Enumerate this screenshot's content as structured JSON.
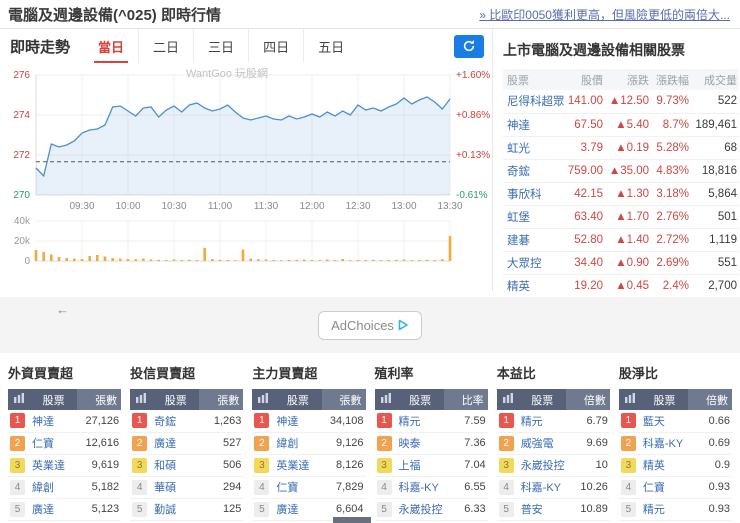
{
  "page": {
    "title": "電腦及週邊設備(^025) 即時行情",
    "promo_link": "» 比歐印0050獲利更高，但風險更低的兩倍大..."
  },
  "chart_panel": {
    "title": "即時走勢",
    "tabs": [
      "當日",
      "二日",
      "三日",
      "四日",
      "五日"
    ],
    "active_tab": "當日",
    "watermark": "WantGoo 玩股網"
  },
  "chart_data": {
    "type": "line",
    "title": "電腦及週邊設備(^025) 當日即時走勢",
    "x": [
      "09:00",
      "09:05",
      "09:10",
      "09:15",
      "09:20",
      "09:25",
      "09:30",
      "09:35",
      "09:40",
      "09:45",
      "09:50",
      "09:55",
      "10:00",
      "10:05",
      "10:10",
      "10:15",
      "10:20",
      "10:25",
      "10:30",
      "10:35",
      "10:40",
      "10:45",
      "10:50",
      "10:55",
      "11:00",
      "11:05",
      "11:10",
      "11:15",
      "11:20",
      "11:25",
      "11:30",
      "11:35",
      "11:40",
      "11:45",
      "11:50",
      "11:55",
      "12:00",
      "12:05",
      "12:10",
      "12:15",
      "12:20",
      "12:25",
      "12:30",
      "12:35",
      "12:40",
      "12:45",
      "12:50",
      "12:55",
      "13:00",
      "13:05",
      "13:10",
      "13:15",
      "13:20",
      "13:25",
      "13:30"
    ],
    "series": [
      {
        "name": "指數",
        "color": "#4a90d2",
        "fill": "rgba(74,144,210,0.13)",
        "values": [
          271.35,
          270.95,
          272.55,
          272.4,
          272.5,
          272.7,
          273.1,
          273.25,
          273.3,
          273.5,
          274.4,
          274.45,
          274.2,
          273.95,
          274.35,
          274.4,
          273.9,
          274.25,
          274.45,
          274.15,
          274.5,
          274.6,
          274.35,
          274.2,
          274.3,
          274.5,
          274.15,
          273.85,
          273.75,
          273.85,
          273.95,
          273.8,
          273.75,
          273.95,
          273.8,
          273.9,
          274.05,
          273.9,
          274.15,
          273.95,
          274.2,
          274.0,
          274.5,
          274.25,
          274.35,
          274.2,
          274.4,
          274.55,
          274.85,
          274.55,
          274.75,
          274.9,
          274.65,
          274.3,
          274.8
        ]
      }
    ],
    "volume": {
      "name": "成交量",
      "color": "#f6a93b",
      "values": [
        11000,
        9000,
        6500,
        4000,
        3000,
        2500,
        2000,
        5000,
        6000,
        4500,
        3000,
        2500,
        2000,
        1800,
        2500,
        1500,
        1200,
        1000,
        1500,
        1000,
        1200,
        900,
        13000,
        2000,
        1200,
        1000,
        800,
        11500,
        2500,
        1800,
        1500,
        1000,
        800,
        1000,
        1200,
        1500,
        1000,
        800,
        1500,
        1000,
        2000,
        800,
        1000,
        900,
        1200,
        800,
        1000,
        1200,
        1500,
        800,
        1000,
        1200,
        900,
        1800,
        25000
      ],
      "ticks": [
        {
          "label": "40k",
          "value": 40000
        },
        {
          "label": "20k",
          "value": 20000
        },
        {
          "label": "0",
          "value": 0
        }
      ]
    },
    "prev_close": 271.66,
    "prev_close_line_color": "#555555",
    "ylim": [
      270,
      276.4
    ],
    "grid": true,
    "y_ticks": [
      {
        "label": "276",
        "value": 276,
        "color": "#c9443c"
      },
      {
        "label": "274",
        "value": 274,
        "color": "#c9443c"
      },
      {
        "label": "272",
        "value": 272,
        "color": "#c9443c"
      },
      {
        "label": "270",
        "value": 270,
        "color": "#2aa05c"
      }
    ],
    "pct_ticks": [
      {
        "label": "+1.60%",
        "color": "#c9443c"
      },
      {
        "label": "+0.86%",
        "color": "#c9443c"
      },
      {
        "label": "+0.13%",
        "color": "#c9443c"
      },
      {
        "label": "-0.61%",
        "color": "#2aa05c"
      }
    ],
    "x_ticks": [
      "09:30",
      "10:00",
      "10:30",
      "11:00",
      "11:30",
      "12:00",
      "12:30",
      "13:00",
      "13:30"
    ]
  },
  "related_stocks": {
    "title": "上市電腦及週邊設備相關股票",
    "columns": [
      "股票",
      "股價",
      "漲跌",
      "漲跌幅",
      "成交量"
    ],
    "rows": [
      {
        "name": "尼得科超眾",
        "price": "141.00",
        "change": "▲12.50",
        "change_pct": "9.73%",
        "volume": "522"
      },
      {
        "name": "神達",
        "price": "67.50",
        "change": "▲5.40",
        "change_pct": "8.7%",
        "volume": "189,461"
      },
      {
        "name": "虹光",
        "price": "3.79",
        "change": "▲0.19",
        "change_pct": "5.28%",
        "volume": "68"
      },
      {
        "name": "奇鋐",
        "price": "759.00",
        "change": "▲35.00",
        "change_pct": "4.83%",
        "volume": "18,816"
      },
      {
        "name": "事欣科",
        "price": "42.15",
        "change": "▲1.30",
        "change_pct": "3.18%",
        "volume": "5,864"
      },
      {
        "name": "虹堡",
        "price": "63.40",
        "change": "▲1.70",
        "change_pct": "2.76%",
        "volume": "501"
      },
      {
        "name": "建碁",
        "price": "52.80",
        "change": "▲1.40",
        "change_pct": "2.72%",
        "volume": "1,119"
      },
      {
        "name": "大眾控",
        "price": "34.40",
        "change": "▲0.90",
        "change_pct": "2.69%",
        "volume": "551"
      },
      {
        "name": "精英",
        "price": "19.20",
        "change": "▲0.45",
        "change_pct": "2.4%",
        "volume": "2,700"
      }
    ]
  },
  "ad": {
    "label": "AdChoices",
    "arrow": "←"
  },
  "ranking": {
    "stock_col": "股票",
    "tables": [
      {
        "title": "外資買賣超",
        "value_col": "張數",
        "rows": [
          {
            "rank": 1,
            "name": "神達",
            "value": "27,126"
          },
          {
            "rank": 2,
            "name": "仁寶",
            "value": "12,616"
          },
          {
            "rank": 3,
            "name": "英業達",
            "value": "9,619"
          },
          {
            "rank": 4,
            "name": "緯創",
            "value": "5,182"
          },
          {
            "rank": 5,
            "name": "廣達",
            "value": "5,123"
          }
        ]
      },
      {
        "title": "投信買賣超",
        "value_col": "張數",
        "rows": [
          {
            "rank": 1,
            "name": "奇鋐",
            "value": "1,263"
          },
          {
            "rank": 2,
            "name": "廣達",
            "value": "527"
          },
          {
            "rank": 3,
            "name": "和碩",
            "value": "506"
          },
          {
            "rank": 4,
            "name": "華碩",
            "value": "294"
          },
          {
            "rank": 5,
            "name": "勤誠",
            "value": "125"
          }
        ]
      },
      {
        "title": "主力買賣超",
        "value_col": "張數",
        "rows": [
          {
            "rank": 1,
            "name": "神達",
            "value": "34,108"
          },
          {
            "rank": 2,
            "name": "緯創",
            "value": "9,126"
          },
          {
            "rank": 3,
            "name": "英業達",
            "value": "8,126"
          },
          {
            "rank": 4,
            "name": "仁寶",
            "value": "7,829"
          },
          {
            "rank": 5,
            "name": "廣達",
            "value": "6,604"
          }
        ]
      },
      {
        "title": "殖利率",
        "value_col": "比率",
        "rows": [
          {
            "rank": 1,
            "name": "精元",
            "value": "7.59"
          },
          {
            "rank": 2,
            "name": "映泰",
            "value": "7.36"
          },
          {
            "rank": 3,
            "name": "上福",
            "value": "7.04"
          },
          {
            "rank": 4,
            "name": "科嘉-KY",
            "value": "6.55"
          },
          {
            "rank": 5,
            "name": "永崴投控",
            "value": "6.33"
          }
        ]
      },
      {
        "title": "本益比",
        "value_col": "倍數",
        "rows": [
          {
            "rank": 1,
            "name": "精元",
            "value": "6.79"
          },
          {
            "rank": 2,
            "name": "威強電",
            "value": "9.69"
          },
          {
            "rank": 3,
            "name": "永崴投控",
            "value": "10"
          },
          {
            "rank": 4,
            "name": "科嘉-KY",
            "value": "10.26"
          },
          {
            "rank": 5,
            "name": "普安",
            "value": "10.89"
          }
        ]
      },
      {
        "title": "股淨比",
        "value_col": "倍數",
        "rows": [
          {
            "rank": 1,
            "name": "藍天",
            "value": "0.66"
          },
          {
            "rank": 2,
            "name": "科嘉-KY",
            "value": "0.69"
          },
          {
            "rank": 3,
            "name": "精英",
            "value": "0.9"
          },
          {
            "rank": 4,
            "name": "仁寶",
            "value": "0.93"
          },
          {
            "rank": 5,
            "name": "精元",
            "value": "0.93"
          }
        ]
      }
    ]
  },
  "colors": {
    "up": "#c9443c",
    "down": "#2aa05c",
    "link": "#3a6cb4",
    "accent_blue": "#1a7ce5",
    "tab_active": "#d9413a",
    "rank_header_bg": "#57617a",
    "rank_value_header_bg": "#6f7990",
    "rank_bg": [
      "#e8564e",
      "#f1a24e",
      "#f2d95c",
      "#ededed",
      "#ededed"
    ],
    "rank_fg": [
      "#ffffff",
      "#ffffff",
      "#8d7a33",
      "#888888",
      "#888888"
    ]
  }
}
